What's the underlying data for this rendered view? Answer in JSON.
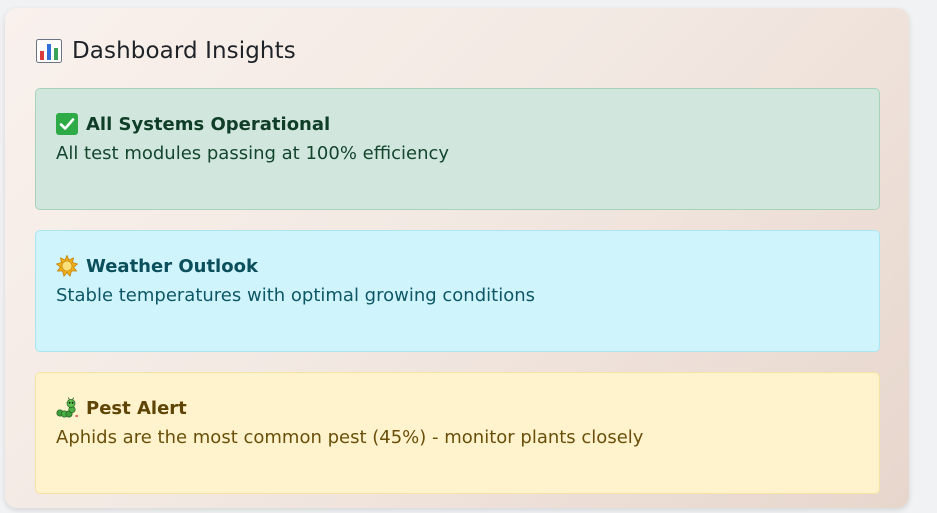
{
  "panel": {
    "title": "Dashboard Insights",
    "title_icon": "bar-chart-icon"
  },
  "cards": [
    {
      "icon": "check-mark-icon",
      "title": "All Systems Operational",
      "text": "All test modules passing at 100% efficiency",
      "variant": "success",
      "color": "#d1e7dd"
    },
    {
      "icon": "sun-icon",
      "title": "Weather Outlook",
      "text": "Stable temperatures with optimal growing conditions",
      "variant": "info",
      "color": "#cff4fc"
    },
    {
      "icon": "caterpillar-icon",
      "title": "Pest Alert",
      "text": "Aphids are the most common pest (45%) - monitor plants closely",
      "variant": "warning",
      "color": "#fff3cd"
    }
  ]
}
